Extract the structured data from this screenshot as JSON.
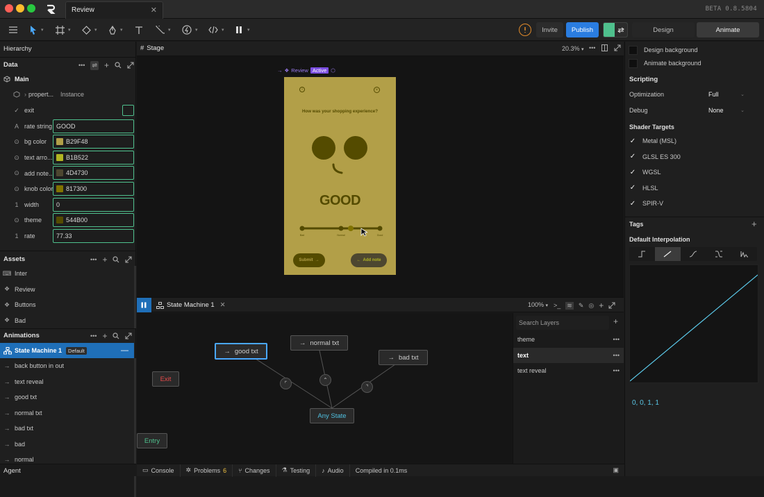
{
  "window": {
    "tab_title": "Review",
    "beta": "BETA 0.8.5804"
  },
  "toolbar": {
    "invite": "Invite",
    "publish": "Publish",
    "design": "Design",
    "animate": "Animate"
  },
  "hierarchy": {
    "title": "Hierarchy"
  },
  "data": {
    "title": "Data",
    "main": "Main",
    "properties": {
      "label": "propert...",
      "value": "Instance"
    },
    "rows": [
      {
        "label": "exit",
        "type": "trigger",
        "value": ""
      },
      {
        "label": "rate string",
        "type": "string",
        "value": "GOOD"
      },
      {
        "label": "bg color",
        "type": "color",
        "value": "B29F48",
        "swatch": "#B29F48"
      },
      {
        "label": "text arro...",
        "type": "color",
        "value": "B1B522",
        "swatch": "#B1B522"
      },
      {
        "label": "add note...",
        "type": "color",
        "value": "4D4730",
        "swatch": "#4D4730"
      },
      {
        "label": "knob color",
        "type": "color",
        "value": "817300",
        "swatch": "#817300"
      },
      {
        "label": "width",
        "type": "number",
        "value": "0"
      },
      {
        "label": "theme",
        "type": "color",
        "value": "544B00",
        "swatch": "#544B00"
      },
      {
        "label": "rate",
        "type": "number",
        "value": "77.33"
      }
    ]
  },
  "assets": {
    "title": "Assets",
    "items": [
      {
        "label": "Inter",
        "icon": "font-icon"
      },
      {
        "label": "Review",
        "icon": "component-icon"
      },
      {
        "label": "Buttons",
        "icon": "component-icon"
      },
      {
        "label": "Bad",
        "icon": "component-icon"
      }
    ]
  },
  "animations": {
    "title": "Animations",
    "selected": "State Machine 1",
    "badge": "Default",
    "items": [
      "back button in out",
      "text reveal",
      "good txt",
      "normal txt",
      "bad txt",
      "bad",
      "normal"
    ]
  },
  "agent": {
    "label": "Agent"
  },
  "stage": {
    "tab": "Stage",
    "zoom": "20.3%",
    "artboard_label": "Review",
    "artboard_badge": "Active",
    "question": "How was your shopping experience?",
    "rating": "GOOD",
    "slider_labels": [
      "Bad",
      "Normal",
      "Good"
    ],
    "slider_value": 0.5,
    "submit": "Submit",
    "add_note": "Add note"
  },
  "state_machine": {
    "tab": "State Machine 1",
    "zoom": "100%",
    "nodes": {
      "good": "good txt",
      "normal": "normal txt",
      "bad": "bad txt",
      "exit": "Exit",
      "any": "Any State",
      "entry": "Entry"
    }
  },
  "layers": {
    "search_placeholder": "Search Layers",
    "items": [
      "theme",
      "text",
      "text reveal"
    ]
  },
  "right": {
    "design_bg": "Design background",
    "animate_bg": "Animate background",
    "scripting": "Scripting",
    "optimization_label": "Optimization",
    "optimization_value": "Full",
    "debug_label": "Debug",
    "debug_value": "None",
    "shader_targets": "Shader Targets",
    "targets": [
      "Metal (MSL)",
      "GLSL ES 300",
      "WGSL",
      "HLSL",
      "SPIR-V"
    ],
    "tags": "Tags",
    "default_interp": "Default Interpolation",
    "curve_values": "0, 0, 1, 1"
  },
  "statusbar": {
    "console": "Console",
    "problems": "Problems",
    "problems_count": "6",
    "changes": "Changes",
    "testing": "Testing",
    "audio": "Audio",
    "compiled": "Compiled in 0.1ms"
  },
  "colors": {
    "accent": "#4fc08d",
    "selected": "#1f6fb8",
    "artboard": "#b29f48",
    "dark": "#544b00",
    "link": "#5bc8e8"
  }
}
